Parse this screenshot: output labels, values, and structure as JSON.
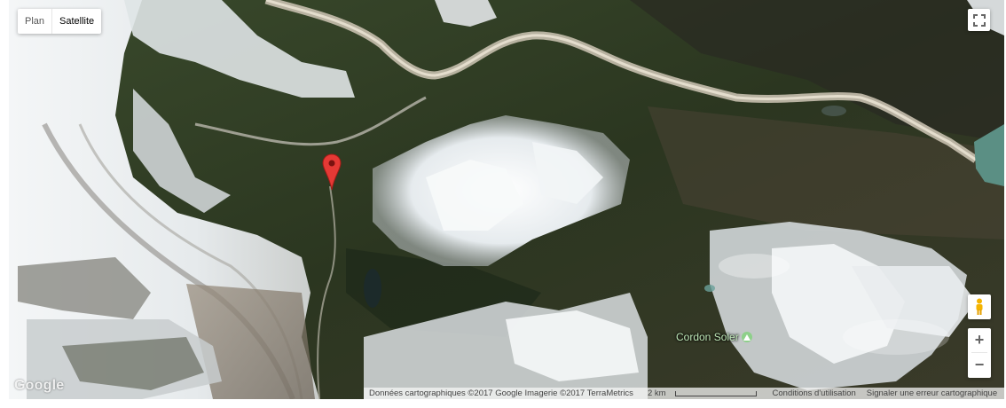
{
  "map_type": {
    "plan_label": "Plan",
    "satellite_label": "Satellite",
    "active": "Satellite"
  },
  "place": {
    "name": "Cordon Soler",
    "icon": "mountain-icon"
  },
  "marker": {
    "icon": "map-pin-icon",
    "color": "#e53935"
  },
  "controls": {
    "zoom_in": "+",
    "zoom_out": "−",
    "fullscreen_icon": "fullscreen-icon",
    "pegman_icon": "pegman-icon"
  },
  "branding": {
    "logo": "Google"
  },
  "attribution": {
    "data": "Données cartographiques ©2017 Google Imagerie ©2017 TerraMetrics",
    "scale": "2 km",
    "terms": "Conditions d'utilisation",
    "report": "Signaler une erreur cartographique"
  }
}
